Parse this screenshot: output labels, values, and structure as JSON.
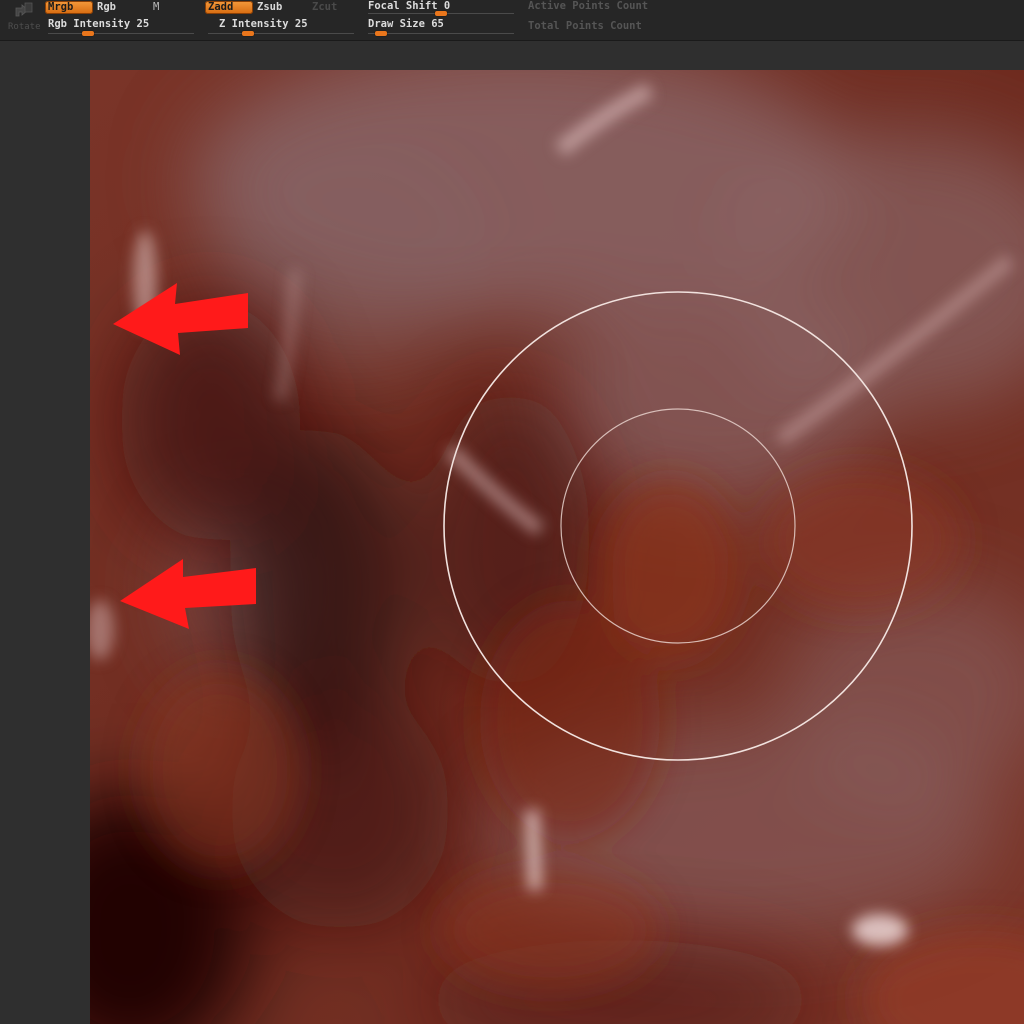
{
  "toolbar": {
    "rotate_label": "Rotate",
    "mrgb_label": "Mrgb",
    "rgb_label": "Rgb",
    "m_label": "M",
    "zadd_label": "Zadd",
    "zsub_label": "Zsub",
    "zcut_label": "Zcut",
    "rgb_intensity_label": "Rgb Intensity",
    "rgb_intensity_value": "25",
    "z_intensity_label": "Z Intensity",
    "z_intensity_value": "25",
    "focal_shift_label": "Focal Shift",
    "focal_shift_value": "0",
    "draw_size_label": "Draw Size",
    "draw_size_value": "65",
    "active_points_label": "Active Points Count",
    "total_points_label": "Total Points Count"
  },
  "sliders": {
    "rgb_intensity_fraction": 0.25,
    "z_intensity_fraction": 0.25,
    "focal_shift_fraction": 0.5,
    "draw_size_fraction": 0.05
  },
  "colors": {
    "accent_orange": "#e9761c",
    "toolbar_bg": "#262626",
    "surface_base": "#6e2e22",
    "annotation_red": "#ff1a1a",
    "cursor_ring": "#f0e0dc"
  }
}
